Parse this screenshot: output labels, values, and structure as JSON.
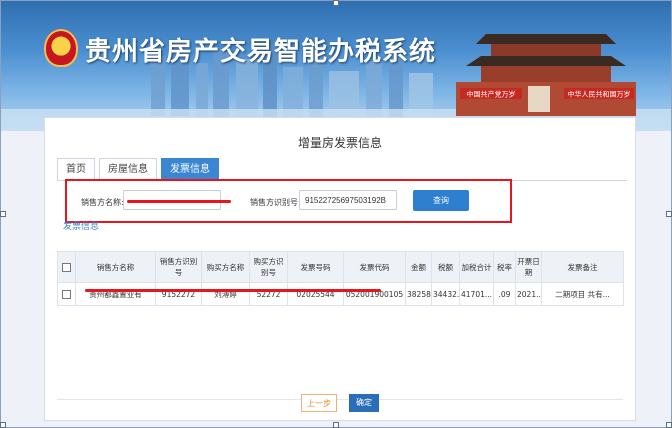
{
  "header": {
    "system_title": "贵州省房产交易智能办税系统",
    "banner_sign_left": "中国共产党万岁",
    "banner_sign_right": "中华人民共和国万岁"
  },
  "panel": {
    "title": "增量房发票信息",
    "tabs": [
      {
        "label": "首页",
        "active": false
      },
      {
        "label": "房屋信息",
        "active": false
      },
      {
        "label": "发票信息",
        "active": true
      }
    ]
  },
  "query": {
    "seller_name_label": "销售方名称:",
    "seller_name_value": "",
    "seller_tax_id_label": "销售方识别号:",
    "seller_tax_id_value": "91522725697503192B",
    "search_button": "查询"
  },
  "section_link": "发票信息",
  "table": {
    "headers": [
      "销售方名称",
      "销售方识别号",
      "购买方名称",
      "购买方识别号",
      "发票号码",
      "发票代码",
      "金额",
      "税额",
      "加税合计",
      "税率",
      "开票日期",
      "发票备注"
    ],
    "rows": [
      {
        "cells": [
          "贵州都鑫置业有",
          "9152272",
          "刘溥婷",
          "52272",
          "02025544",
          "052001900105",
          "38258...",
          "34432...",
          "41701...",
          ".09",
          "2021...",
          "二期项目 共有..."
        ]
      }
    ]
  },
  "footer": {
    "prev_button": "上一步",
    "confirm_button": "确定"
  },
  "colors": {
    "accent": "#3b86d1",
    "redaction": "#e8161c",
    "confirm": "#2a6db8",
    "prev": "#e8892f"
  }
}
